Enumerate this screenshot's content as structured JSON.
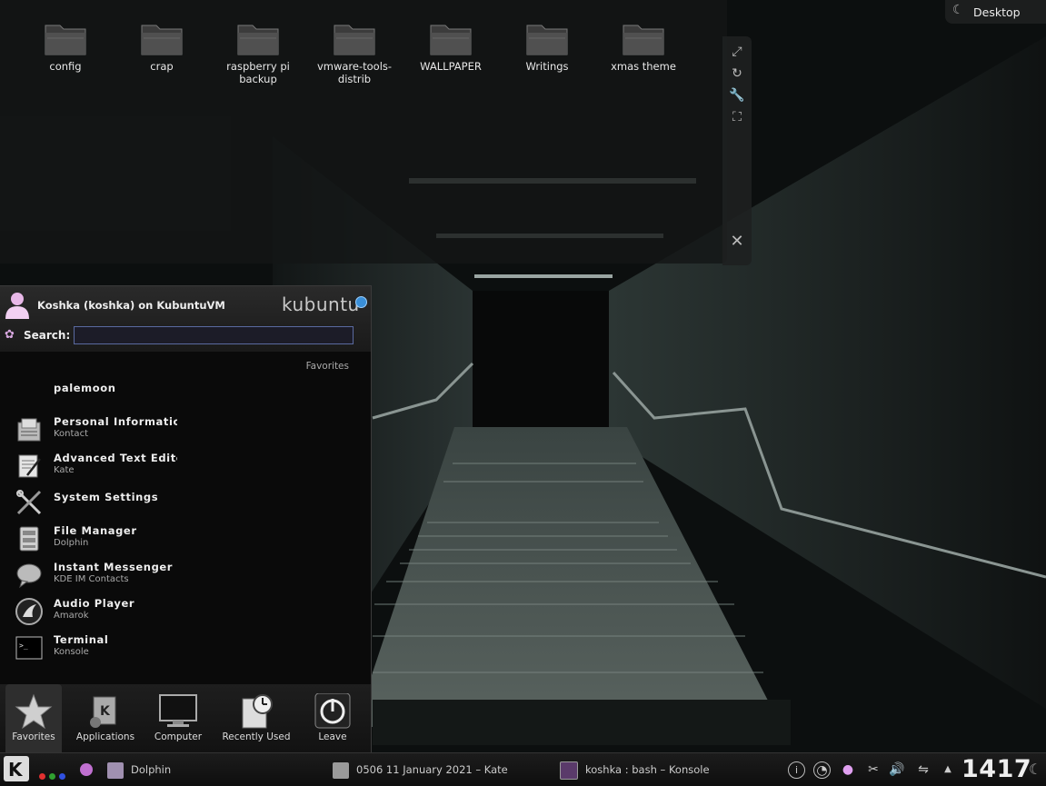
{
  "desktop": {
    "toolbox_label": "Desktop",
    "folders": [
      {
        "label": "config"
      },
      {
        "label": "crap"
      },
      {
        "label": "raspberry pi backup"
      },
      {
        "label": "vmware-tools-distrib"
      },
      {
        "label": "WALLPAPER"
      },
      {
        "label": "Writings"
      },
      {
        "label": "xmas theme"
      }
    ]
  },
  "toolbox": {
    "icons": [
      "resize-icon",
      "rotate-icon",
      "settings-wrench-icon",
      "fullscreen-icon",
      "close-icon"
    ]
  },
  "kickoff": {
    "user_line": "Koshka (koshka) on KubuntuVM",
    "logo_text": "kubuntu",
    "search_label": "Search:",
    "search_value": "",
    "favorites_heading": "Favorites",
    "favorites": [
      {
        "name": "palemoon",
        "sub": ""
      },
      {
        "name": "Personal Information Manag",
        "sub": "Kontact"
      },
      {
        "name": "Advanced Text Editor",
        "sub": "Kate"
      },
      {
        "name": "System Settings",
        "sub": ""
      },
      {
        "name": "File Manager",
        "sub": "Dolphin"
      },
      {
        "name": "Instant Messenger Contac",
        "sub": "KDE IM Contacts"
      },
      {
        "name": "Audio Player",
        "sub": "Amarok"
      },
      {
        "name": "Terminal",
        "sub": "Konsole"
      }
    ],
    "tabs": [
      {
        "label": "Favorites",
        "active": true
      },
      {
        "label": "Applications",
        "active": false
      },
      {
        "label": "Computer",
        "active": false
      },
      {
        "label": "Recently Used",
        "active": false
      },
      {
        "label": "Leave",
        "active": false
      }
    ]
  },
  "panel": {
    "tasks": [
      {
        "label": "Dolphin"
      },
      {
        "label": "0506 11 January 2021 – Kate"
      },
      {
        "label": "koshka : bash – Konsole"
      }
    ],
    "clock": "1417",
    "tray_icons": [
      "info-icon",
      "network-manager-icon",
      "notification-bulb-icon",
      "klipper-scissors-icon",
      "volume-icon",
      "usb-device-icon",
      "expand-arrow-icon"
    ]
  },
  "colors": {
    "search_border": "#5a6aa0",
    "panel_bg": "#141414",
    "menu_bg": "#0a0a0a"
  }
}
